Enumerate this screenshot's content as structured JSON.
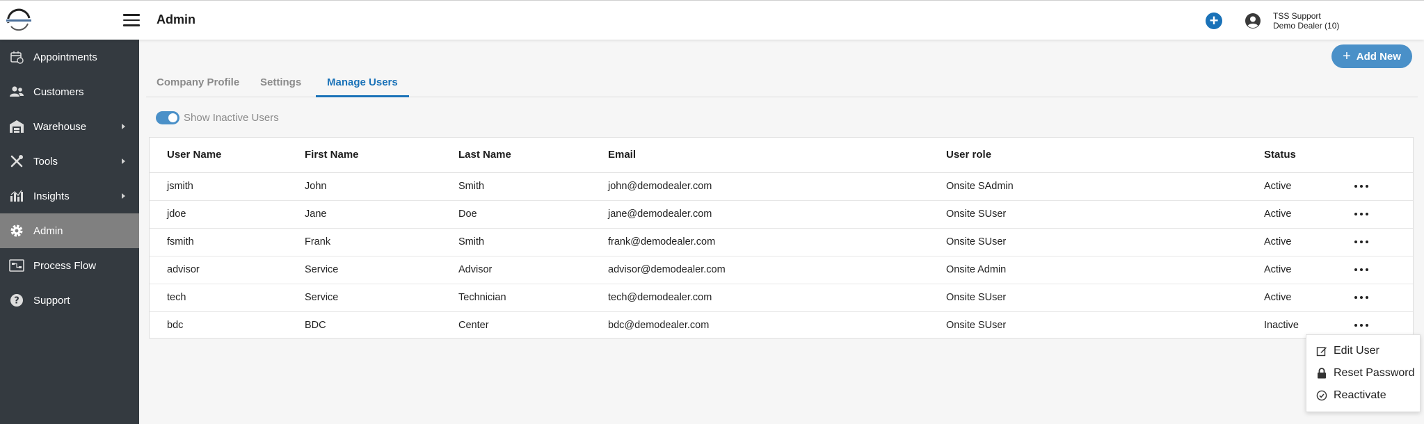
{
  "header": {
    "title": "Admin",
    "user_name": "TSS Support",
    "dealer": "Demo Dealer (10)"
  },
  "sidebar": {
    "items": [
      {
        "label": "Appointments",
        "icon": "calendar-icon"
      },
      {
        "label": "Customers",
        "icon": "users-icon"
      },
      {
        "label": "Warehouse",
        "icon": "warehouse-icon"
      },
      {
        "label": "Tools",
        "icon": "tools-icon"
      },
      {
        "label": "Insights",
        "icon": "chart-icon"
      },
      {
        "label": "Admin",
        "icon": "gear-icon"
      },
      {
        "label": "Process Flow",
        "icon": "process-flow-icon"
      },
      {
        "label": "Support",
        "icon": "help-icon"
      }
    ]
  },
  "toolbar": {
    "add_new": "Add New"
  },
  "tabs": [
    {
      "label": "Company Profile"
    },
    {
      "label": "Settings"
    },
    {
      "label": "Manage Users"
    }
  ],
  "filters": {
    "show_inactive": "Show Inactive Users"
  },
  "table": {
    "headers": [
      "User Name",
      "First Name",
      "Last Name",
      "Email",
      "User role",
      "Status"
    ],
    "rows": [
      [
        "jsmith",
        "John",
        "Smith",
        "john@demodealer.com",
        "Onsite SAdmin",
        "Active"
      ],
      [
        "jdoe",
        "Jane",
        "Doe",
        "jane@demodealer.com",
        "Onsite SUser",
        "Active"
      ],
      [
        "fsmith",
        "Frank",
        "Smith",
        "frank@demodealer.com",
        "Onsite SUser",
        "Active"
      ],
      [
        "advisor",
        "Service",
        "Advisor",
        "advisor@demodealer.com",
        "Onsite Admin",
        "Active"
      ],
      [
        "tech",
        "Service",
        "Technician",
        "tech@demodealer.com",
        "Onsite SUser",
        "Active"
      ],
      [
        "bdc",
        "BDC",
        "Center",
        "bdc@demodealer.com",
        "Onsite SUser",
        "Inactive"
      ]
    ]
  },
  "context_menu": {
    "items": [
      {
        "label": "Edit User",
        "icon": "edit-icon"
      },
      {
        "label": "Reset Password",
        "icon": "lock-icon"
      },
      {
        "label": "Reactivate",
        "icon": "check-circle-icon"
      }
    ]
  },
  "colors": {
    "accent": "#1a72b8",
    "button": "#4a90c8",
    "sidebar": "#343a40",
    "sidebar_active": "#808080"
  }
}
